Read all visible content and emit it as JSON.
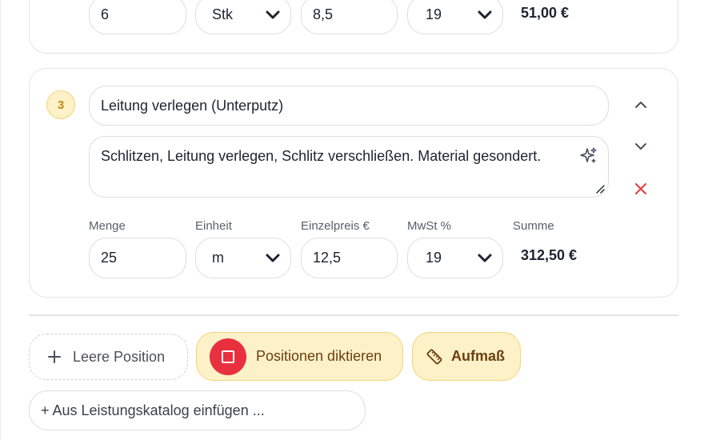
{
  "prev_position": {
    "menge": "6",
    "einheit": "Stk",
    "einzelpreis": "8,5",
    "mwst": "19",
    "summe": "51,00 €"
  },
  "position3": {
    "number": "3",
    "title": "Leitung verlegen (Unterputz)",
    "description": "Schlitzen, Leitung verlegen, Schlitz verschließen. Material gesondert.",
    "labels": {
      "menge": "Menge",
      "einheit": "Einheit",
      "einzelpreis": "Einzelpreis €",
      "mwst": "MwSt %",
      "summe": "Summe"
    },
    "menge": "25",
    "einheit": "m",
    "einzelpreis": "12,5",
    "mwst": "19",
    "summe": "312,50 €"
  },
  "actions": {
    "leere_position": "Leere Position",
    "diktieren": "Positionen diktieren",
    "aufmass": "Aufmaß",
    "katalog": "+ Aus Leistungskatalog einfügen ..."
  },
  "icons": {
    "add": "plus-icon",
    "record": "stop-record-icon",
    "ruler": "ruler-icon",
    "move_up": "chevron-up-icon",
    "move_down": "chevron-down-icon",
    "delete": "close-icon",
    "ai": "sparkle-icon"
  },
  "colors": {
    "accent_bg": "#fdf1c7",
    "accent_border": "#f2d57a",
    "record_red": "#e8303f",
    "delete_red": "#e5393b"
  }
}
